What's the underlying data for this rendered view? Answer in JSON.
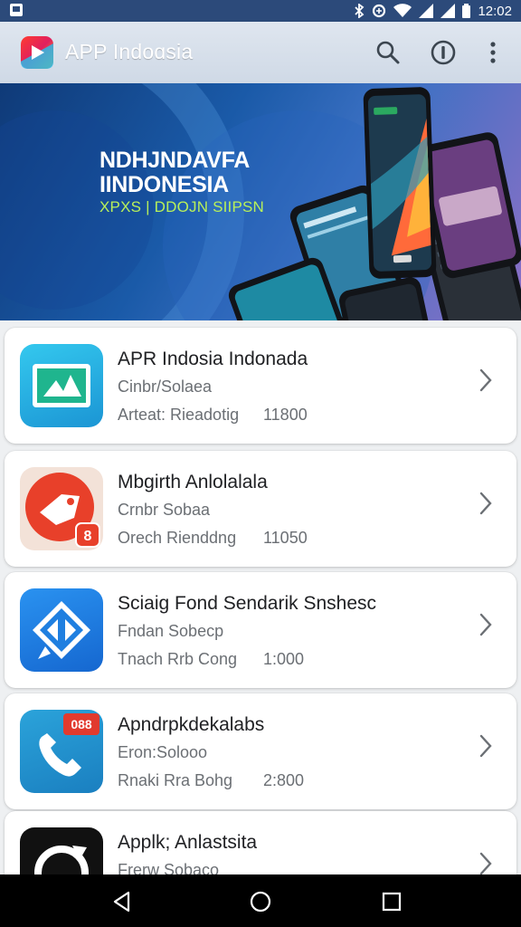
{
  "status_bar": {
    "time": "12:02",
    "icons": [
      "screenshot-icon",
      "bluetooth-icon",
      "data-saver-icon",
      "wifi-icon",
      "signal-icon",
      "signal-icon-2",
      "battery-icon"
    ]
  },
  "app_bar": {
    "title": "APP Indoɑsia",
    "actions": [
      "search-icon",
      "info-icon",
      "more-vert-icon"
    ]
  },
  "hero": {
    "title_line1": "NDHJNDAVFA",
    "title_line2": "IINDONESIA",
    "subtitle": "XPXS | DDOJN SIIPSN"
  },
  "apps": [
    {
      "name": "APR Indosia Indonada",
      "publisher": "Cinbr/Solaea",
      "category": "Arteat:  Rieadotig",
      "count": "11800",
      "icon": "app-icon-1",
      "color": "#1fb2d9"
    },
    {
      "name": "Mbgirth Anlolalala",
      "publisher": "Crnbr Sobaa",
      "category": "Orech  Rienddng",
      "count": "11050",
      "icon": "app-icon-2",
      "color": "#e8482c"
    },
    {
      "name": "Sciaig Fond Sendarik Snshesc",
      "publisher": "Fndan Sobecp",
      "category": "Tnach  Rrb Cong",
      "count": "1:000",
      "icon": "app-icon-3",
      "color": "#1f7fe0"
    },
    {
      "name": "Apndrpkdekalabs",
      "publisher": "Eron:Solooo",
      "category": "Rnaki  Rra Bohg",
      "count": "2:800",
      "icon": "app-icon-4",
      "color": "#2290cf",
      "badge": "088"
    },
    {
      "name": "Applk; Anlastsita",
      "publisher": "Frerw Sobaco",
      "category": "",
      "count": "",
      "icon": "app-icon-5",
      "color": "#111111"
    }
  ],
  "nav_bar": {
    "buttons": [
      "back-icon",
      "home-icon",
      "recents-icon"
    ]
  },
  "colors": {
    "status_bar": "#2c4a7a",
    "accent": "#1fb2d9",
    "hero_subtitle": "#b8f05a"
  }
}
